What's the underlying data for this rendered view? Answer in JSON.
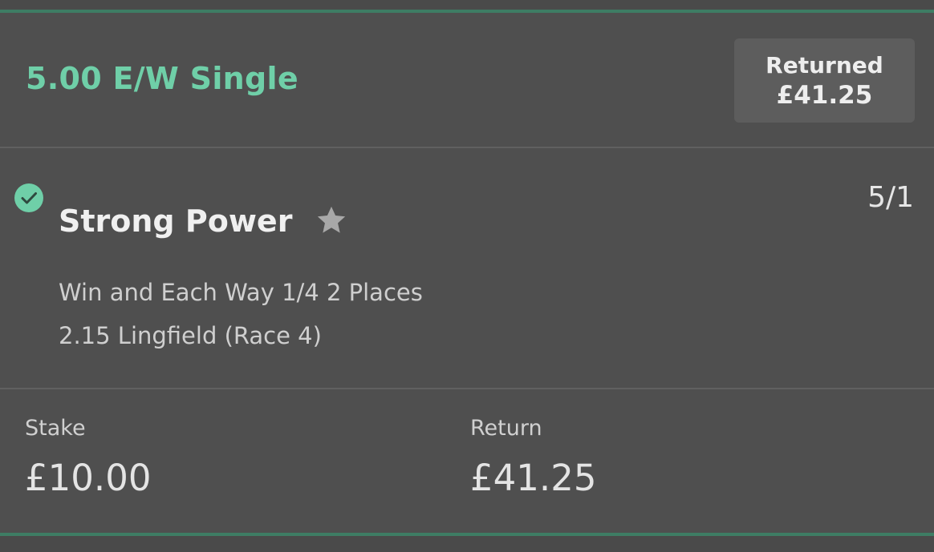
{
  "bet": {
    "title": "5.00 E/W Single",
    "returned_label": "Returned",
    "returned_amount": "£41.25"
  },
  "selection": {
    "status_icon": "check-circle-icon",
    "name": "Strong Power",
    "favourite_icon": "star-icon",
    "odds": "5/1",
    "market": "Win and Each Way 1/4 2 Places",
    "event": "2.15 Lingfield (Race 4)"
  },
  "summary": {
    "stake_label": "Stake",
    "stake_value": "£10.00",
    "return_label": "Return",
    "return_value": "£41.25"
  },
  "colors": {
    "accent": "#6fcfa8",
    "background": "#4f4f4f",
    "panel": "#5d5d5d",
    "divider_green": "#3e7d64"
  }
}
